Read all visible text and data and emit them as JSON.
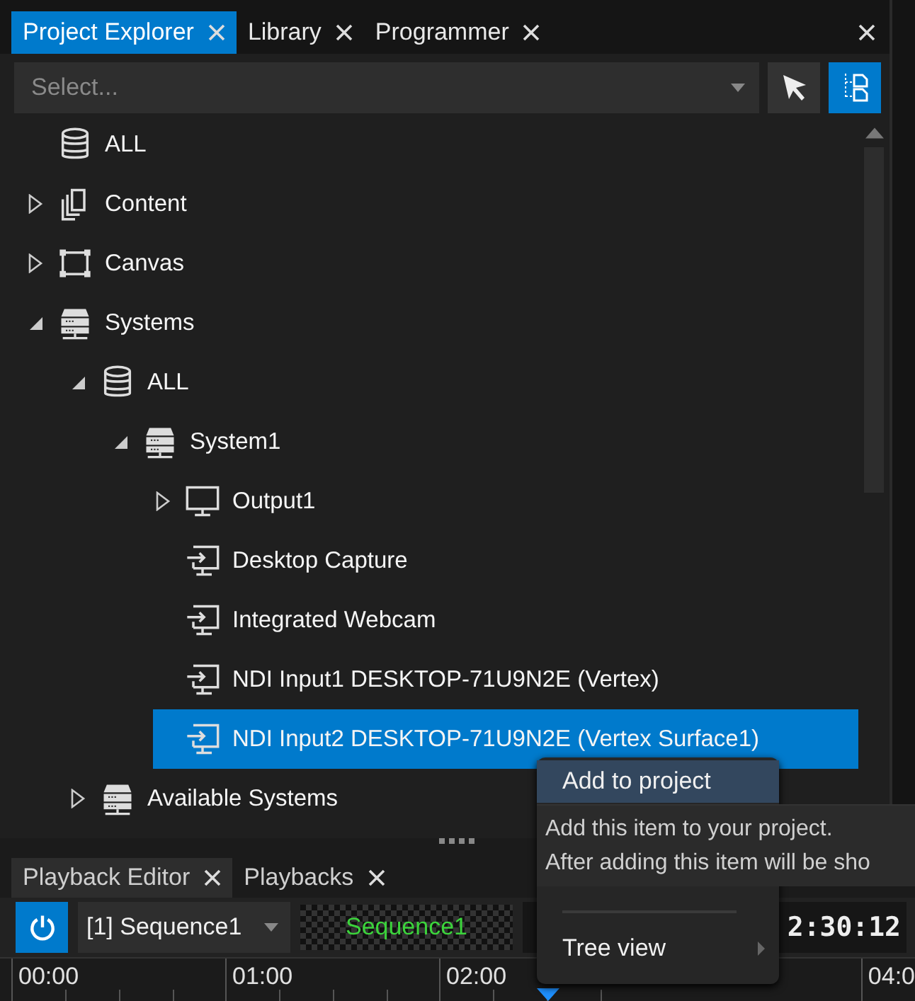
{
  "top_tabs": [
    {
      "label": "Project Explorer",
      "selected": true
    },
    {
      "label": "Library",
      "selected": false
    },
    {
      "label": "Programmer",
      "selected": false
    }
  ],
  "toolbar": {
    "placeholder": "Select...",
    "tree_mode": {
      "on": true
    }
  },
  "tree": [
    {
      "kind": "database",
      "label": "ALL",
      "selected": false
    },
    {
      "kind": "content",
      "label": "Content",
      "selected": false,
      "expanded": false
    },
    {
      "kind": "canvas",
      "label": "Canvas",
      "selected": false,
      "expanded": false
    },
    {
      "kind": "system",
      "label": "Systems",
      "selected": false,
      "expanded": true,
      "children": [
        {
          "kind": "database",
          "label": "ALL",
          "selected": false,
          "expanded": true,
          "children": [
            {
              "kind": "system",
              "label": "System1",
              "selected": false,
              "expanded": true,
              "children": [
                {
                  "kind": "monitor",
                  "label": "Output1",
                  "selected": false,
                  "expanded": false
                },
                {
                  "kind": "input",
                  "label": "Desktop Capture",
                  "selected": false
                },
                {
                  "kind": "input",
                  "label": "Integrated Webcam",
                  "selected": false
                },
                {
                  "kind": "input",
                  "label": "NDI Input1 DESKTOP-71U9N2E (Vertex)",
                  "selected": false
                },
                {
                  "kind": "input",
                  "label": "NDI Input2 DESKTOP-71U9N2E (Vertex Surface1)",
                  "selected": true
                }
              ]
            }
          ]
        },
        {
          "kind": "system",
          "label": "Available Systems",
          "selected": false,
          "expanded": false
        }
      ]
    }
  ],
  "bottom_tabs": [
    {
      "label": "Playback Editor",
      "selected": true
    },
    {
      "label": "Playbacks",
      "selected": false
    }
  ],
  "playback": {
    "power": {
      "on": true
    },
    "sequence": "[1] Sequence1",
    "preview_label": "Sequence1",
    "timecode": "2:30:12"
  },
  "timeline": {
    "labels": [
      "00:00",
      "01:00",
      "02:00"
    ],
    "edge_label": "04:0"
  },
  "context_menu": [
    {
      "kind": "item",
      "label": "Add to project",
      "selected": true
    },
    {
      "kind": "separator"
    },
    {
      "kind": "submenu",
      "label": "Tree view",
      "selected": false
    }
  ],
  "tooltip": [
    "Add this item to your project.",
    "After adding this item will be sho"
  ]
}
